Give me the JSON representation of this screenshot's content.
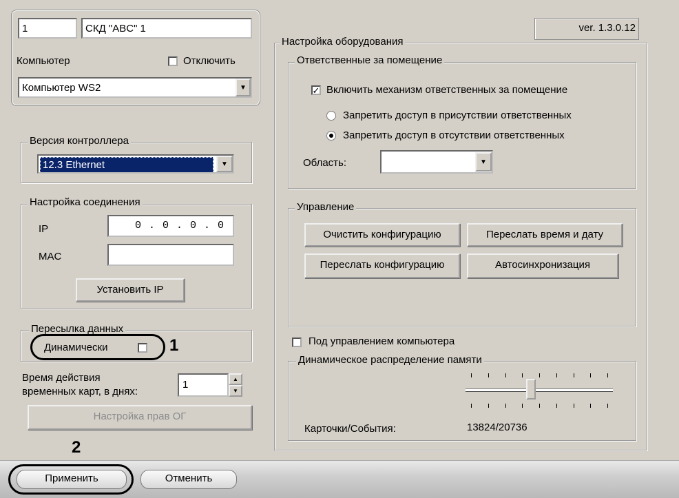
{
  "object": {
    "id": "1",
    "name": "СКД \"ABC\" 1"
  },
  "computer": {
    "label": "Компьютер",
    "disable_label": "Отключить",
    "disable_checked": false,
    "selected": "Компьютер WS2"
  },
  "version": "ver. 1.3.0.12",
  "controller_version": {
    "title": "Версия контроллера",
    "selected": "12.3 Ethernet"
  },
  "connection": {
    "title": "Настройка соединения",
    "ip_label": "IP",
    "ip_value": "0 . 0 . 0 . 0",
    "mac_label": "MAC",
    "mac_value": "",
    "set_ip_button": "Установить IP"
  },
  "data_transfer": {
    "title": "Пересылка данных",
    "dynamic_label": "Динамически",
    "dynamic_checked": false
  },
  "card_validity": {
    "label_line1": "Время действия",
    "label_line2": "временных карт, в днях:",
    "value": "1"
  },
  "og_rights_button": "Настройка прав ОГ",
  "hardware": {
    "title": "Настройка оборудования",
    "responsible": {
      "title": "Ответственные за помещение",
      "enable_label": "Включить механизм ответственных за помещение",
      "enable_checked": true,
      "radio1": "Запретить доступ в присутствии ответственных",
      "radio2": "Запретить доступ в отсутствии ответственных",
      "selected_radio": 2,
      "area_label": "Область:",
      "area_value": ""
    },
    "control": {
      "title": "Управление",
      "clear_config": "Очистить конфигурацию",
      "send_time": "Переслать время и дату",
      "send_config": "Переслать конфигурацию",
      "autosync": "Автосинхронизация"
    },
    "computer_control": {
      "label": "Под управлением компьютера",
      "checked": false
    },
    "memory": {
      "title": "Динамическое распределение памяти",
      "slider_fraction": 0.44,
      "cards_events_label": "Карточки/События:",
      "cards_events_value": "13824/20736"
    }
  },
  "annotations": {
    "mark1": "1",
    "mark2": "2"
  },
  "footer": {
    "apply": "Применить",
    "cancel": "Отменить"
  }
}
